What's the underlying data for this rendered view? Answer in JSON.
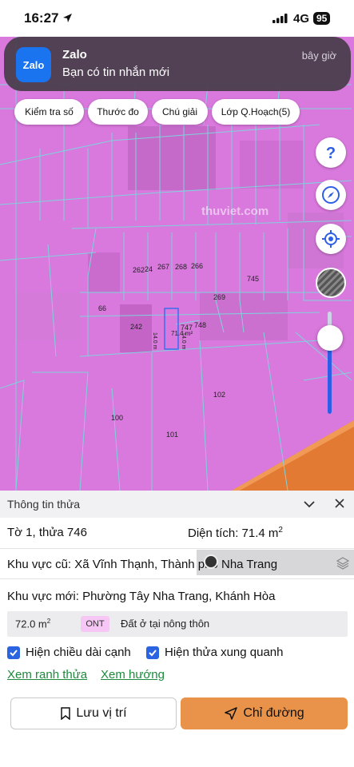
{
  "status_bar": {
    "time": "16:27",
    "network": "4G",
    "battery": "95"
  },
  "notification": {
    "icon_label": "Zalo",
    "app": "Zalo",
    "message": "Bạn có tin nhắn mới",
    "time": "bây giờ"
  },
  "toolbar": {
    "chips": [
      "Kiểm tra số",
      "Thước đo",
      "Chú giải",
      "Lớp Q.Hoạch(5)"
    ]
  },
  "map": {
    "watermark": "thuviet.com",
    "parcel_labels": [
      "262",
      "24",
      "267",
      "268",
      "266",
      "745",
      "269",
      "66",
      "242",
      "747",
      "748",
      "102",
      "100",
      "101"
    ],
    "selected_parcel": {
      "area_label": "71.4 m²",
      "edge_label_1": "14.0 m",
      "edge_label_2": "14.0 m"
    },
    "opacity_level": 0.7
  },
  "panel": {
    "title": "Thông tin thửa",
    "sheet_parcel": "Tờ 1, thửa 746",
    "area_label": "Diện tích: 71.4 m",
    "area_sup": "2",
    "old_region": "Khu vực cũ: Xã Vĩnh Thạnh, Thành phố Nha Trang",
    "new_region": "Khu vực mới: Phường Tây Nha Trang, Khánh Hòa",
    "zone": {
      "area": "72.0 m",
      "area_sup": "2",
      "code": "ONT",
      "description": "Đất ở tại nông thôn"
    },
    "options": {
      "show_edge_length": "Hiện chiều dài cạnh",
      "show_neighbors": "Hiện thửa xung quanh"
    },
    "links": {
      "view_boundary": "Xem ranh thửa",
      "view_direction": "Xem hướng"
    },
    "buttons": {
      "save_location": "Lưu vị trí",
      "directions": "Chỉ đường"
    }
  },
  "colors": {
    "zone_pink": "#d978dd",
    "parcel_line": "#7fd2dc",
    "orange_zone": "#e37a34",
    "accent_blue": "#2b64e0",
    "link_green": "#1d8a3d",
    "direction_button": "#e8924a"
  }
}
